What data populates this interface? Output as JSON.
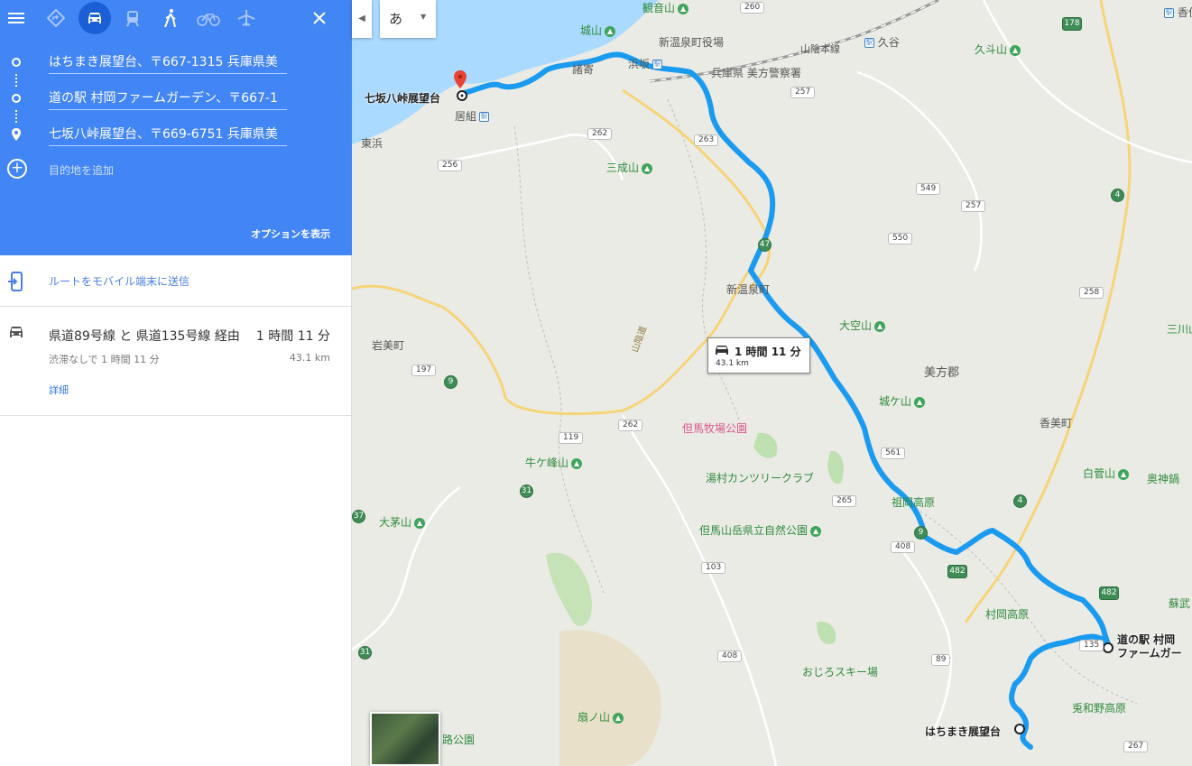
{
  "panel": {
    "waypoints": [
      "はちまき展望台、〒667-1315 兵庫県美",
      "道の駅 村岡ファームガーデン、〒667-1",
      "七坂八峠展望台、〒669-6751 兵庫県美"
    ],
    "add_destination": "目的地を追加",
    "options": "オプションを表示",
    "send_to_mobile": "ルートをモバイル端末に送信",
    "route": {
      "via": "県道89号線 と 県道135号線 経由",
      "time": "1 時間 11 分",
      "traffic": "渋滞なしで 1 時間 11 分",
      "distance": "43.1 km",
      "details": "詳細"
    }
  },
  "map": {
    "ime_char": "あ",
    "route_box": {
      "time": "1 時間 11 分",
      "distance": "43.1 km"
    },
    "route_color": "#1a9bf0",
    "markers": {
      "start": "はちまき展望台",
      "mid": "道の駅 村岡\nファームガー",
      "end": "七坂八峠展望台"
    },
    "places": {
      "kanonsan": "観音山",
      "shirosan": "城山",
      "shinonsen_office": "新温泉町役場",
      "police": "兵庫県 美方警察署",
      "sanin_line": "山陰本線",
      "kutani": "久谷",
      "kyutosan": "久斗山",
      "kasumi": "香住",
      "moroyose": "諸寄",
      "hamasaka": "浜坂",
      "igumi": "居組",
      "higashihama": "東浜",
      "sanseisan": "三成山",
      "shinonsen": "新温泉町",
      "iwami": "岩美町",
      "ozorasan": "大空山",
      "mikata": "美方郡",
      "jogasan": "城ケ山",
      "kami": "香美町",
      "tajima_farm": "但馬牧場公園",
      "yumura_club": "湯村カンツリークラブ",
      "ushigamine": "牛ケ峰山",
      "shirasugasan": "白菅山",
      "sokaokogen": "祖岡高原",
      "tajima_park": "但馬山岳県立自然公園",
      "okayasan": "大茅山",
      "mikawa": "三川山",
      "okukami": "奥神鍋",
      "soutake": "蘇武",
      "muraoka_kogen": "村岡高原",
      "ojiro_ski": "おじろスキー場",
      "uwanoko": "兎和野高原",
      "ogiyama": "扇ノ山",
      "michi_park": "路公園",
      "sanin_road": "山陰道"
    },
    "shields": {
      "r260": "260",
      "r178": "178",
      "r257a": "257",
      "r263": "263",
      "r262a": "262",
      "r256": "256",
      "r549": "549",
      "r257b": "257",
      "r4a": "4",
      "r550": "550",
      "r47": "47",
      "r258": "258",
      "r197": "197",
      "r9a": "9",
      "r262b": "262",
      "r119": "119",
      "r31a": "31",
      "r561": "561",
      "r265": "265",
      "r4b": "4",
      "r37": "37",
      "r9b": "9",
      "r408a": "408",
      "r103": "103",
      "r482a": "482",
      "r482b": "482",
      "r135": "135",
      "r31b": "31",
      "r408b": "408",
      "r89": "89",
      "r267": "267"
    }
  }
}
